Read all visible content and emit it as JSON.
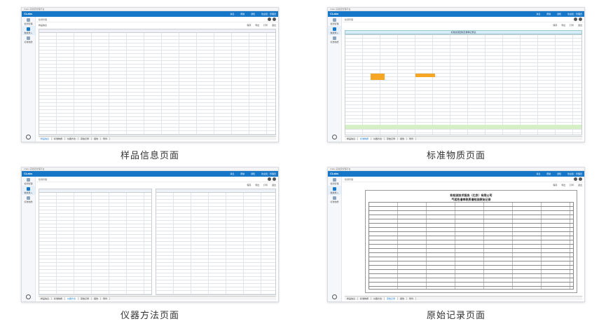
{
  "app": {
    "title_bar": "Clabs 实验室管理平台",
    "brand": "CLabs",
    "top_right": [
      "消息",
      "帮助",
      "通知",
      "欢迎您：管理员"
    ],
    "crumb": "检测管理",
    "toolbar_label": "样品信息",
    "tools": [
      "保存",
      "导出",
      "打印",
      "退出"
    ],
    "sidebar": [
      "检测管理",
      "数据录入",
      "标准物质",
      "仪器设备"
    ]
  },
  "panels": [
    {
      "caption": "样品信息页面",
      "sheet_tabs": [
        "样品信息",
        "标准物质",
        "仪器方法",
        "原始记录",
        "报告",
        "附件"
      ]
    },
    {
      "caption": "标准物质页面",
      "table_title": "标准溶液配制及稀释记录表",
      "sheet_tabs": [
        "样品信息",
        "标准物质",
        "仪器方法",
        "原始记录",
        "报告",
        "附件"
      ]
    },
    {
      "caption": "仪器方法页面",
      "sheet_tabs": [
        "样品信息",
        "标准物质",
        "仪器方法",
        "原始记录",
        "报告",
        "附件"
      ]
    },
    {
      "caption": "原始记录页面",
      "doc_title": "和检测技术服务（北京）有限公司",
      "doc_subtitle": "气相色谱串联质谱检测原始记录",
      "sheet_tabs": [
        "样品信息",
        "标准物质",
        "仪器方法",
        "原始记录",
        "报告",
        "附件"
      ]
    }
  ],
  "colors": {
    "accent": "#1677c9",
    "highlight": "#f6a623",
    "table_head": "#d7ecf8"
  }
}
